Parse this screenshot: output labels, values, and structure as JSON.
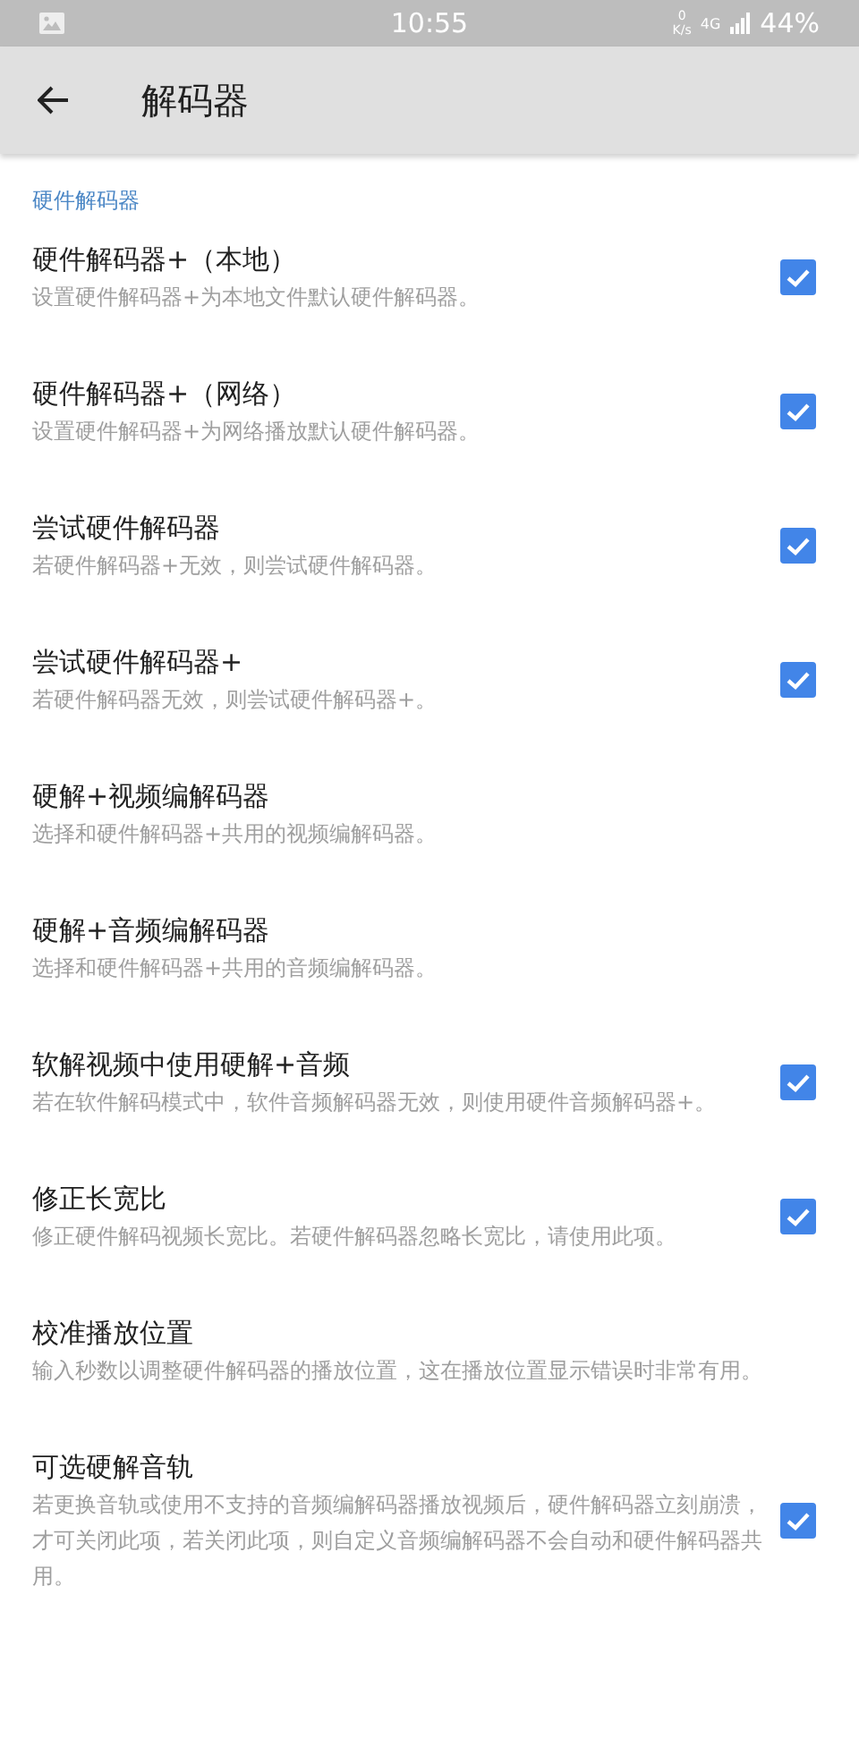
{
  "status_bar": {
    "time": "10:55",
    "speed_value": "0",
    "speed_unit": "K/s",
    "network": "4G",
    "battery": "44%"
  },
  "toolbar": {
    "title": "解码器"
  },
  "section": {
    "header": "硬件解码器"
  },
  "items": [
    {
      "kind": "checkbox",
      "title": "硬件解码器+（本地）",
      "summary": "设置硬件解码器+为本地文件默认硬件解码器。",
      "checked": true
    },
    {
      "kind": "checkbox",
      "title": "硬件解码器+（网络）",
      "summary": "设置硬件解码器+为网络播放默认硬件解码器。",
      "checked": true
    },
    {
      "kind": "checkbox",
      "title": "尝试硬件解码器",
      "summary": "若硬件解码器+无效，则尝试硬件解码器。",
      "checked": true
    },
    {
      "kind": "checkbox",
      "title": "尝试硬件解码器+",
      "summary": "若硬件解码器无效，则尝试硬件解码器+。",
      "checked": true
    },
    {
      "kind": "plain",
      "title": "硬解+视频编解码器",
      "summary": "选择和硬件解码器+共用的视频编解码器。"
    },
    {
      "kind": "plain",
      "title": "硬解+音频编解码器",
      "summary": "选择和硬件解码器+共用的音频编解码器。"
    },
    {
      "kind": "checkbox",
      "title": "软解视频中使用硬解+音频",
      "summary": "若在软件解码模式中，软件音频解码器无效，则使用硬件音频解码器+。",
      "checked": true
    },
    {
      "kind": "checkbox",
      "title": "修正长宽比",
      "summary": "修正硬件解码视频长宽比。若硬件解码器忽略长宽比，请使用此项。",
      "checked": true
    },
    {
      "kind": "plain",
      "title": "校准播放位置",
      "summary": "输入秒数以调整硬件解码器的播放位置，这在播放位置显示错误时非常有用。"
    },
    {
      "kind": "checkbox",
      "title": "可选硬解音轨",
      "summary": "若更换音轨或使用不支持的音频编解码器播放视频后，硬件解码器立刻崩溃，才可关闭此项，若关闭此项，则自定义音频编解码器不会自动和硬件解码器共用。",
      "checked": true
    }
  ]
}
